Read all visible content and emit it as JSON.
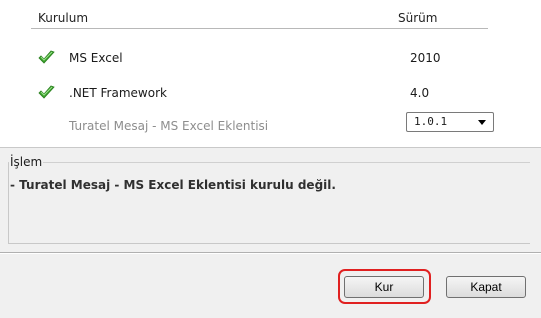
{
  "table": {
    "header_install": "Kurulum",
    "header_version": "Sürüm"
  },
  "items": [
    {
      "name": "MS Excel",
      "version": "2010",
      "status_icon": "checkmark-icon",
      "status_color": "#3aa12b"
    },
    {
      "name": ".NET Framework",
      "version": "4.0",
      "status_icon": "checkmark-icon",
      "status_color": "#3aa12b"
    },
    {
      "name": "Turatel Mesaj - MS Excel Eklentisi",
      "version_select": "1.0.1"
    }
  ],
  "operation": {
    "title": "İşlem",
    "message": "- Turatel Mesaj - MS Excel Eklentisi kurulu değil."
  },
  "buttons": {
    "install_label": "Kur",
    "close_label": "Kapat"
  },
  "colors": {
    "highlight": "#e02020"
  }
}
